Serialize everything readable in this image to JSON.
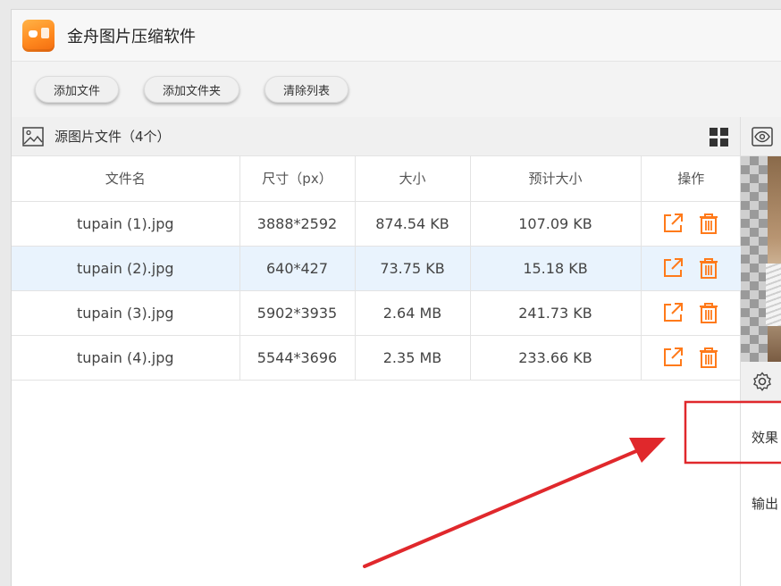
{
  "app": {
    "title": "金舟图片压缩软件"
  },
  "toolbar": {
    "add_file": "添加文件",
    "add_folder": "添加文件夹",
    "clear_list": "清除列表"
  },
  "source_panel": {
    "title": "源图片文件（4个）"
  },
  "table": {
    "headers": [
      "文件名",
      "尺寸（px）",
      "大小",
      "预计大小",
      "操作"
    ],
    "rows": [
      {
        "name": "tupain (1).jpg",
        "dims": "3888*2592",
        "size": "874.54 KB",
        "est": "107.09 KB"
      },
      {
        "name": "tupain (2).jpg",
        "dims": "640*427",
        "size": "73.75 KB",
        "est": "15.18 KB"
      },
      {
        "name": "tupain (3).jpg",
        "dims": "5902*3935",
        "size": "2.64 MB",
        "est": "241.73 KB"
      },
      {
        "name": "tupain (4).jpg",
        "dims": "5544*3696",
        "size": "2.35 MB",
        "est": "233.66 KB"
      }
    ],
    "selected_row": 1
  },
  "right_panel": {
    "effect_label": "效果",
    "output_label": "输出"
  },
  "colors": {
    "accent_orange": "#ff7a1a",
    "selected_row": "#e9f3fd",
    "annotation_red": "#e0282c"
  }
}
